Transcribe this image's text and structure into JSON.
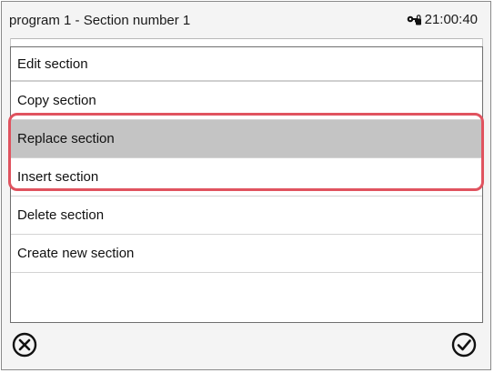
{
  "header": {
    "title": "program 1 - Section number 1",
    "time": "21:00:40",
    "lock_icon": "key-lock-icon"
  },
  "menu": {
    "heading": "Edit section",
    "items": [
      {
        "label": "Copy section",
        "selected": false
      },
      {
        "label": "Replace section",
        "selected": true
      },
      {
        "label": "Insert section",
        "selected": false
      },
      {
        "label": "Delete section",
        "selected": false
      },
      {
        "label": "Create new section",
        "selected": false
      }
    ]
  },
  "footer": {
    "cancel_icon": "close-circle-icon",
    "confirm_icon": "check-circle-icon"
  },
  "colors": {
    "highlight": "#e0535f",
    "selected_row": "#c4c4c4"
  }
}
